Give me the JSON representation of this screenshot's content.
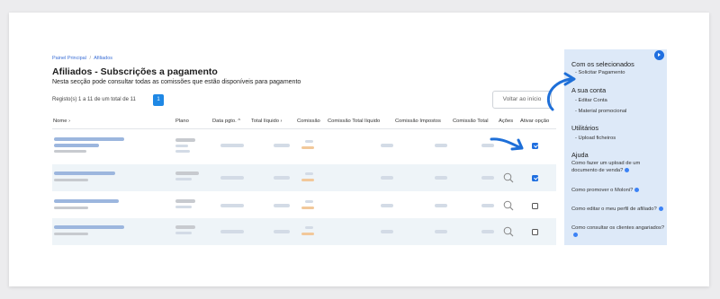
{
  "breadcrumb": {
    "items": [
      "Painel Principal",
      "Afiliados"
    ],
    "separator": "/"
  },
  "page": {
    "title": "Afiliados - Subscrições a pagamento",
    "subtitle": "Nesta secção pode consultar todas as comissões que estão disponíveis para pagamento"
  },
  "records": {
    "info": "Registo(s) 1 a 11 de um total de 11",
    "current_page": "1"
  },
  "actions": {
    "back_label": "Voltar ao início"
  },
  "table": {
    "headers": {
      "name": "Nome ›",
      "plan": "Plano",
      "date": "Data pgto. ^",
      "net_total": "Total líquido ›",
      "commission": "Comissão",
      "commission_net": "Comissão Total líquido",
      "commission_tax": "Comissão Impostos",
      "commission_total": "Comissão Total",
      "actions": "Ações",
      "activate": "Ativar opção"
    },
    "rows": [
      {
        "shaded": false,
        "checked": true,
        "has_search": false
      },
      {
        "shaded": true,
        "checked": true,
        "has_search": true
      },
      {
        "shaded": false,
        "checked": false,
        "has_search": true
      },
      {
        "shaded": true,
        "checked": false,
        "has_search": true
      }
    ]
  },
  "sidebar": {
    "selected_title": "Com os selecionados",
    "selected_items": [
      "- Solicitar Pagamento"
    ],
    "account_title": "A sua conta",
    "account_items": [
      "- Editar Conta",
      "- Material promocional"
    ],
    "utilities_title": "Utilitários",
    "utilities_items": [
      "- Upload ficheiros"
    ],
    "help_title": "Ajuda",
    "help_items": [
      "Como fazer um upload de um documento de venda?",
      "Como promover o Moloni?",
      "Como editar o meu perfil de afiliado?",
      "Como consultar os clientes angariados?"
    ]
  },
  "colors": {
    "accent": "#1f6fe0",
    "sidebar_bg": "#dde9f8",
    "row_shade": "#eef4f8"
  },
  "icons": [
    "search-icon",
    "play-icon",
    "checkbox-icon",
    "arrow-annotation"
  ]
}
